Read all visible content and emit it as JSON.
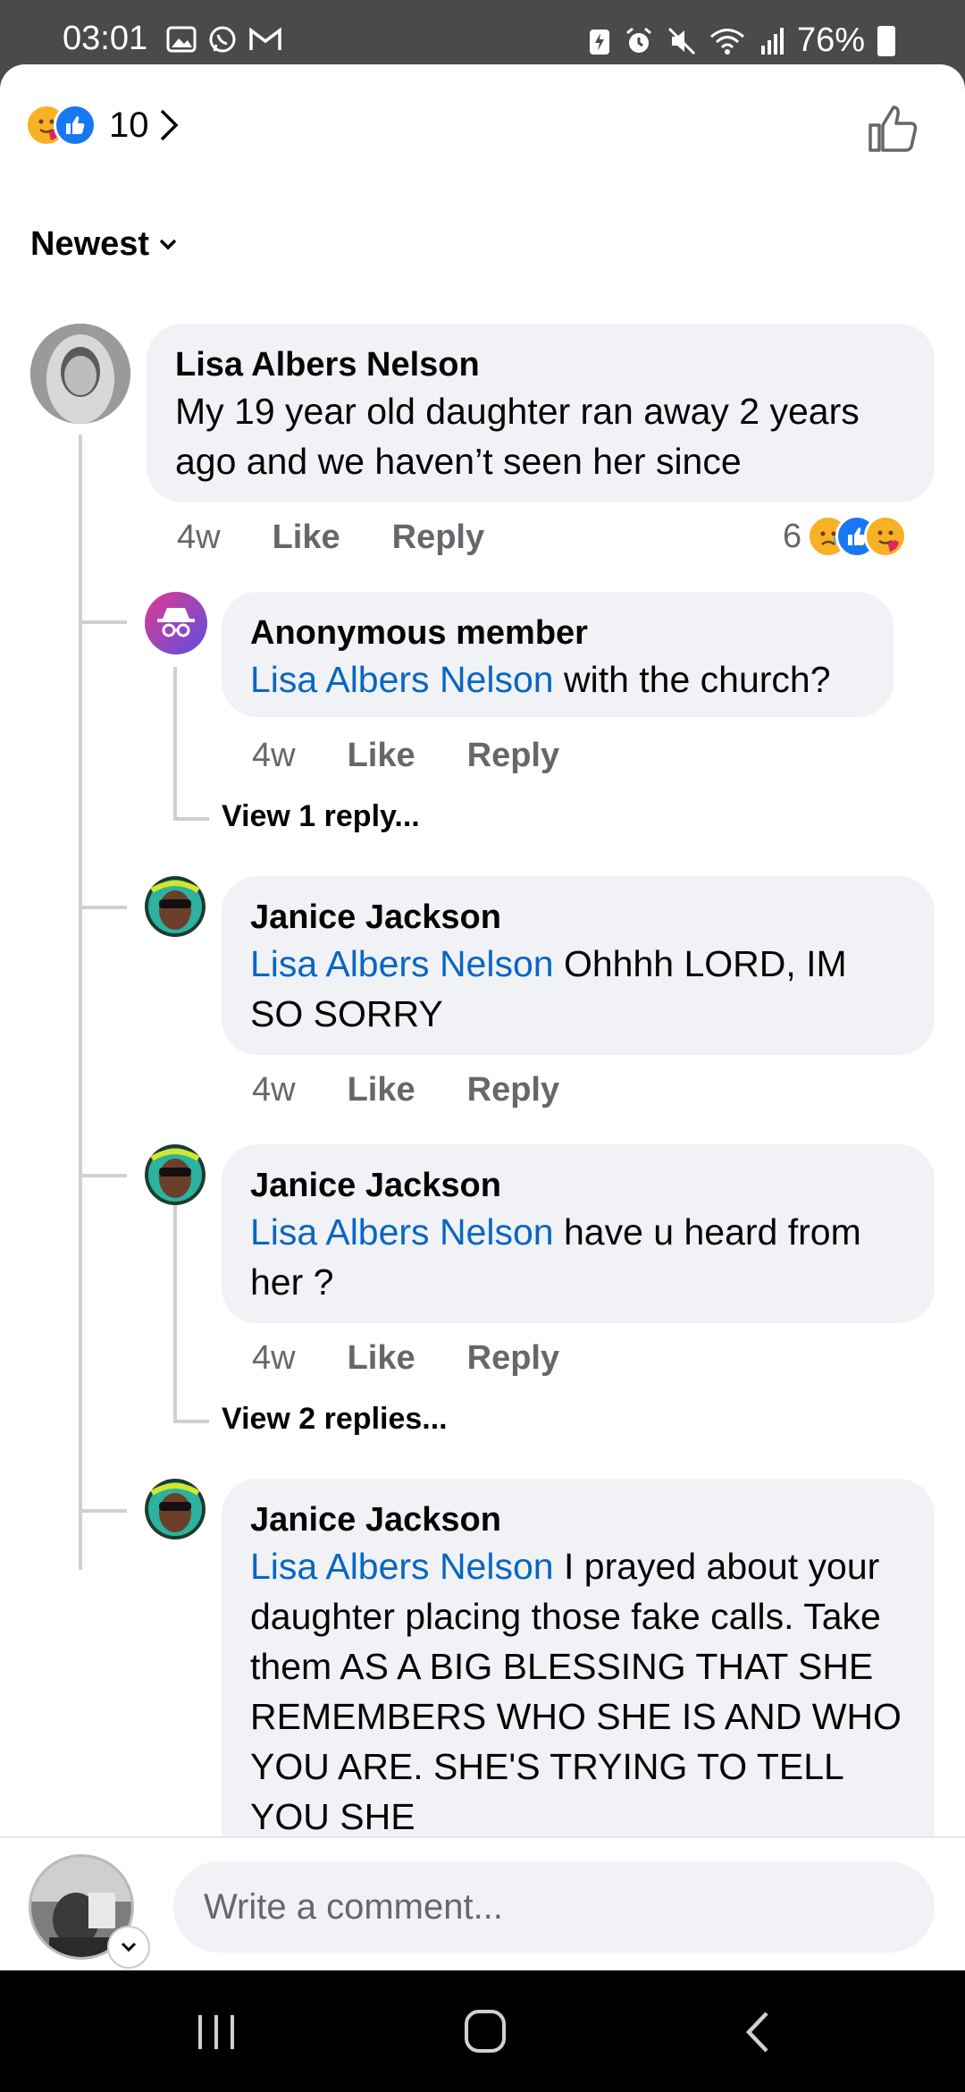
{
  "status_bar": {
    "time": "03:01",
    "battery": "76%"
  },
  "header": {
    "reaction_count": "10"
  },
  "sort": {
    "label": "Newest"
  },
  "comments": [
    {
      "author": "Lisa Albers Nelson",
      "text": "My 19 year old daughter ran away 2 years ago and we haven’t seen her since",
      "time": "4w",
      "like": "Like",
      "reply": "Reply",
      "reaction_count": "6"
    }
  ],
  "replies": [
    {
      "author": "Anonymous member",
      "mention": "Lisa Albers Nelson",
      "text": "with the church?",
      "time": "4w",
      "like": "Like",
      "reply": "Reply",
      "view_replies": "View 1 reply..."
    },
    {
      "author": "Janice Jackson",
      "mention": "Lisa Albers Nelson",
      "text": "Ohhhh LORD, IM SO SORRY",
      "time": "4w",
      "like": "Like",
      "reply": "Reply"
    },
    {
      "author": "Janice Jackson",
      "mention": "Lisa Albers Nelson",
      "text": "have u heard from her ?",
      "time": "4w",
      "like": "Like",
      "reply": "Reply",
      "view_replies": "View 2 replies..."
    },
    {
      "author": "Janice Jackson",
      "mention": "Lisa Albers Nelson",
      "text": "I prayed about your daughter placing those fake calls. Take them AS A BIG BLESSING THAT SHE REMEMBERS WHO SHE IS AND WHO YOU ARE. SHE'S TRYING TO TELL YOU SHE"
    }
  ],
  "composer": {
    "placeholder": "Write a comment..."
  },
  "colors": {
    "mention": "#0a66c2",
    "bubble": "#f0f2f5",
    "like_blue": "#1877f2"
  }
}
